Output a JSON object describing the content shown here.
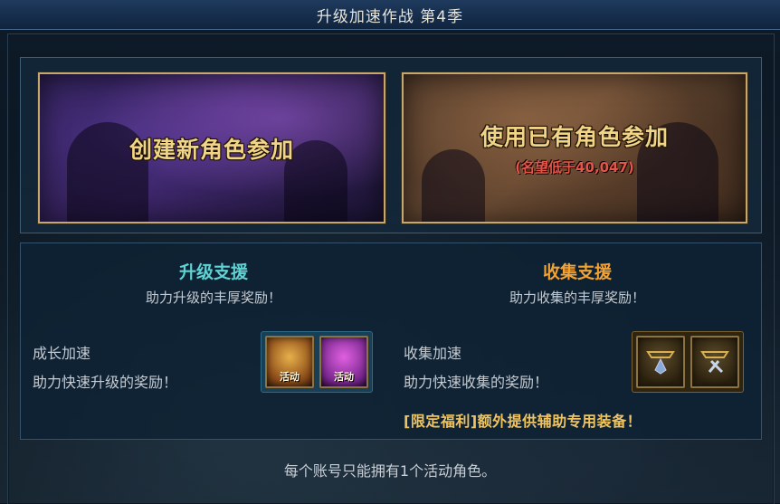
{
  "window": {
    "title": "升级加速作战 第4季"
  },
  "cards": {
    "new_character": {
      "label": "创建新角色参加"
    },
    "existing_character": {
      "label": "使用已有角色参加",
      "sub": "(名望低于40,047)"
    }
  },
  "levelup_support": {
    "title": "升级支援",
    "desc": "助力升级的丰厚奖励！",
    "item_label": "成长加速",
    "item_desc": "助力快速升级的奖励！",
    "slots": [
      {
        "tag": "活动"
      },
      {
        "tag": "活动"
      }
    ]
  },
  "collect_support": {
    "title": "收集支援",
    "desc": "助力收集的丰厚奖励！",
    "item_label": "收集加速",
    "item_desc": "助力快速收集的奖励！",
    "limited": "[限定福利]额外提供辅助专用装备！"
  },
  "footer": {
    "note": "每个账号只能拥有1个活动角色。"
  },
  "colors": {
    "levelup_title": "#5fd3d3",
    "collect_title": "#f2a233",
    "limited_text": "#efc460",
    "card_text": "#f1d486",
    "card_sub": "#e2574a"
  }
}
